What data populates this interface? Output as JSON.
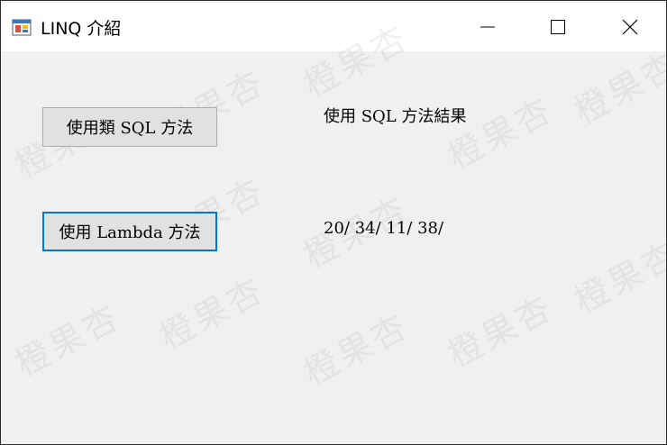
{
  "window": {
    "title": "LINQ 介紹",
    "icon": "winforms-app-icon",
    "controls": {
      "minimize_icon": "minimize-icon",
      "maximize_icon": "maximize-icon",
      "close_icon": "close-icon"
    }
  },
  "form": {
    "sql_button_label": "使用類 SQL 方法",
    "lambda_button_label": "使用 Lambda 方法",
    "sql_result_label": "使用 SQL 方法結果",
    "lambda_result_label": "20/ 34/ 11/ 38/"
  },
  "watermark": {
    "text": "橙果杏"
  },
  "colors": {
    "focus_border": "#0078d7",
    "client_background": "#f0f0f0",
    "button_face": "#e1e1e1"
  }
}
